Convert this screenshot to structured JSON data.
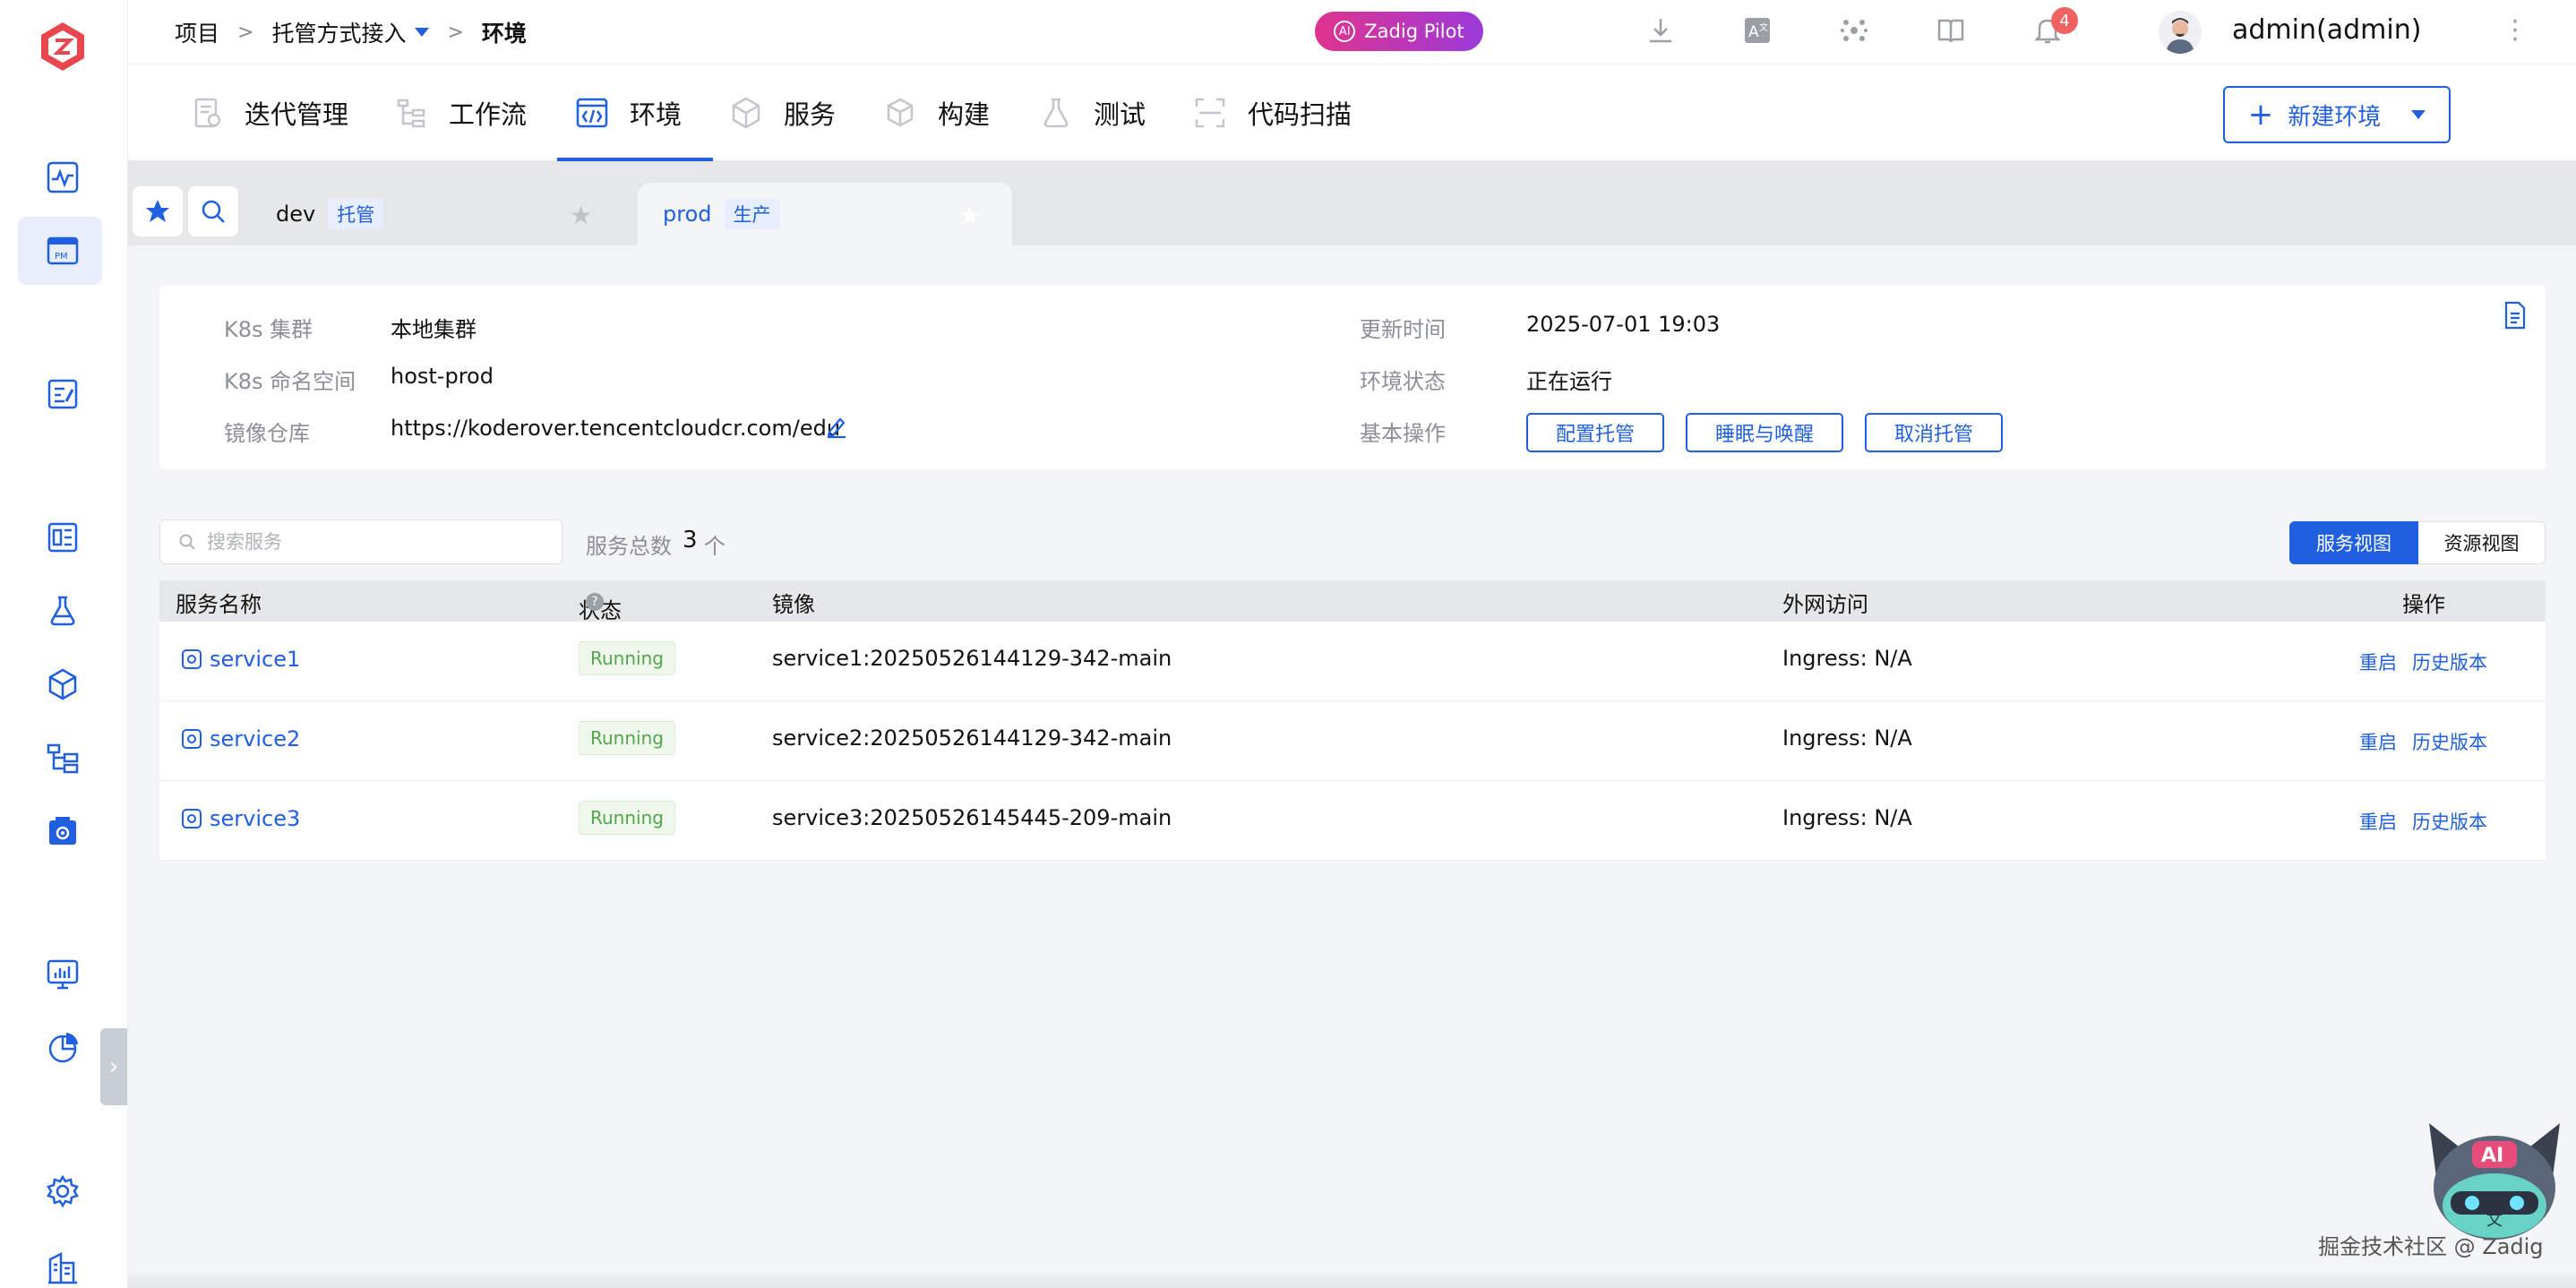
{
  "colors": {
    "accent": "#1f5fe0",
    "running_green": "#52a64b",
    "notification_red": "#f06262",
    "pilot_gradient": [
      "#e0338f",
      "#9b3ad8"
    ]
  },
  "header": {
    "breadcrumb": {
      "root": "项目",
      "project": "托管方式接入",
      "current": "环境"
    },
    "pilot_label": "Zadig Pilot",
    "notification_count": "4",
    "user": "admin(admin)",
    "icons": [
      "download-icon",
      "translate-icon",
      "plugins-icon",
      "docs-icon",
      "bell-icon"
    ]
  },
  "nav": {
    "tabs": [
      {
        "label": "迭代管理",
        "icon": "iteration-icon"
      },
      {
        "label": "工作流",
        "icon": "workflow-icon"
      },
      {
        "label": "环境",
        "icon": "environment-icon",
        "active": true
      },
      {
        "label": "服务",
        "icon": "service-icon"
      },
      {
        "label": "构建",
        "icon": "build-icon"
      },
      {
        "label": "测试",
        "icon": "test-icon"
      },
      {
        "label": "代码扫描",
        "icon": "scan-icon"
      }
    ],
    "new_env_label": "新建环境"
  },
  "env_tabs": [
    {
      "name": "dev",
      "tag": "托管"
    },
    {
      "name": "prod",
      "tag": "生产",
      "active": true
    }
  ],
  "info": {
    "k8s_cluster_label": "K8s 集群",
    "k8s_cluster": "本地集群",
    "k8s_ns_label": "K8s 命名空间",
    "k8s_ns": "host-prod",
    "registry_label": "镜像仓库",
    "registry": "https://koderover.tencentcloudcr.com/edu",
    "updated_label": "更新时间",
    "updated": "2025-07-01 19:03",
    "status_label": "环境状态",
    "status": "正在运行",
    "ops_label": "基本操作",
    "ops": [
      "配置托管",
      "睡眠与唤醒",
      "取消托管"
    ]
  },
  "filter": {
    "search_placeholder": "搜索服务",
    "total_label": "服务总数",
    "total": "3",
    "unit": "个",
    "view_service": "服务视图",
    "view_resource": "资源视图"
  },
  "table": {
    "headers": {
      "name": "服务名称",
      "status": "状态(3/3)",
      "image": "镜像",
      "ingress": "外网访问",
      "ops": "操作"
    },
    "rows": [
      {
        "name": "service1",
        "status": "Running",
        "image": "service1:20250526144129-342-main",
        "ingress": "Ingress: N/A",
        "restart": "重启",
        "history": "历史版本"
      },
      {
        "name": "service2",
        "status": "Running",
        "image": "service2:20250526144129-342-main",
        "ingress": "Ingress: N/A",
        "restart": "重启",
        "history": "历史版本"
      },
      {
        "name": "service3",
        "status": "Running",
        "image": "service3:20250526145445-209-main",
        "ingress": "Ingress: N/A",
        "restart": "重启",
        "history": "历史版本"
      }
    ]
  },
  "footer": {
    "watermark": "掘金技术社区 @ Zadig"
  }
}
